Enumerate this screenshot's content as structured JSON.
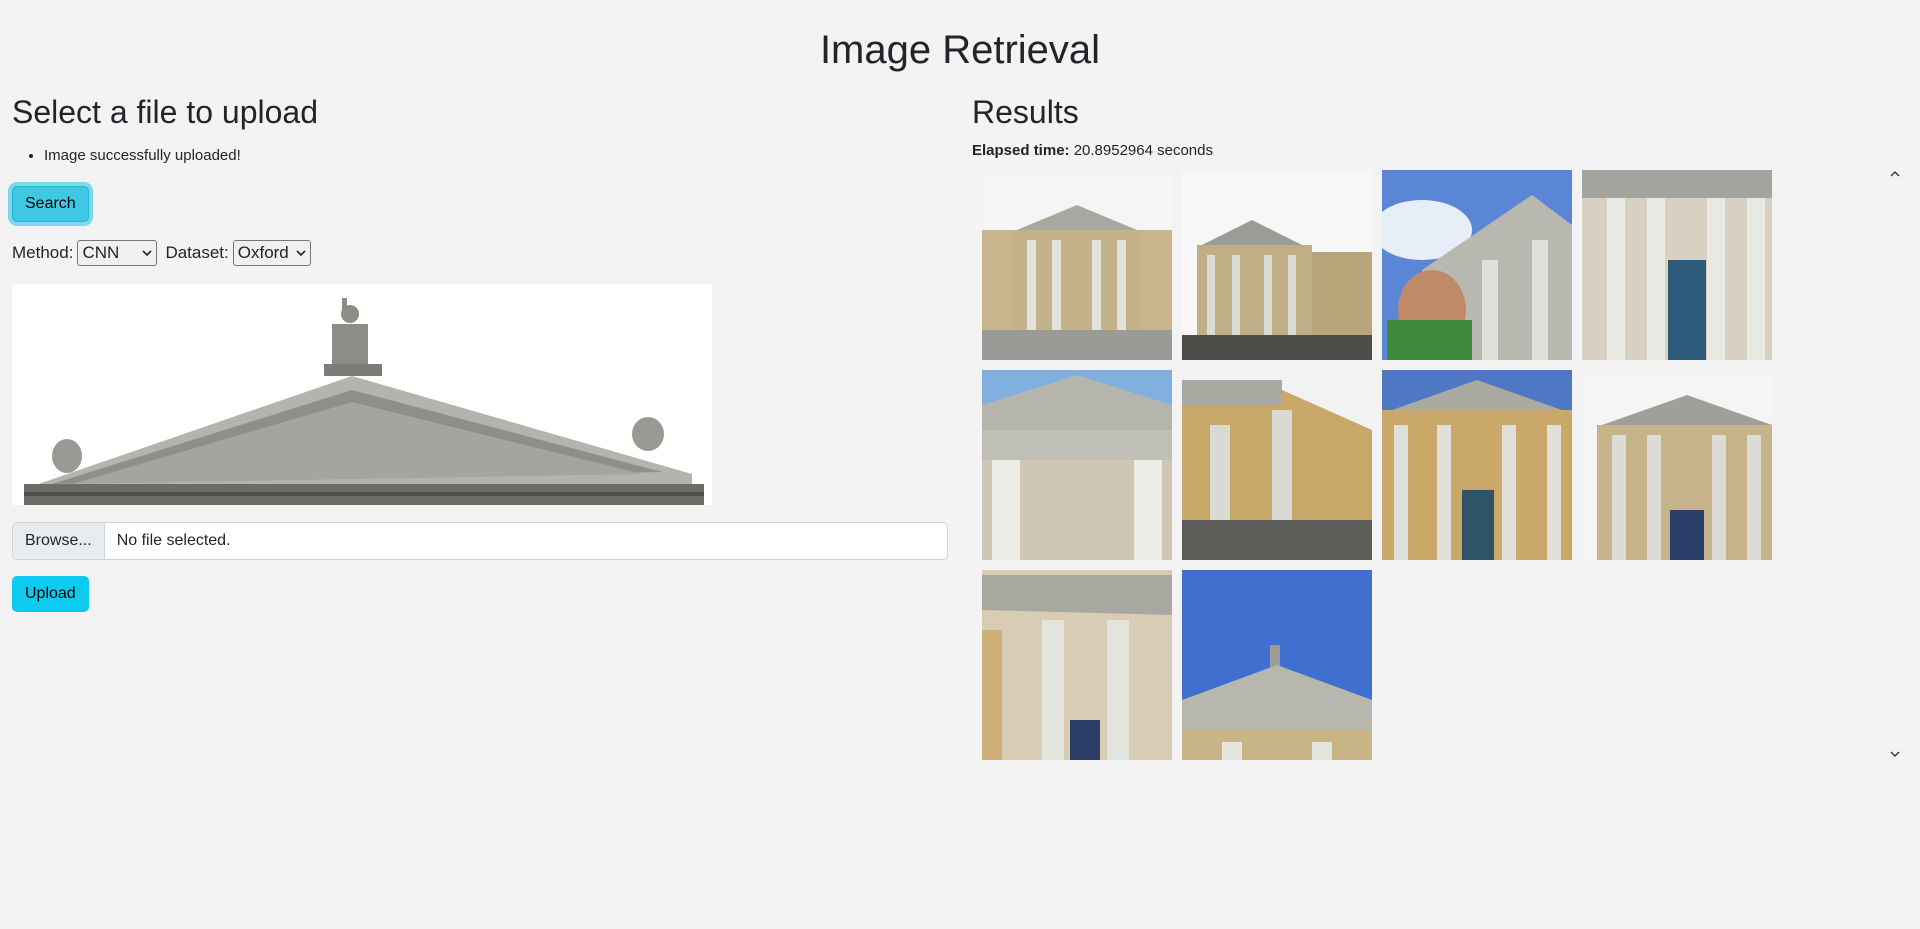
{
  "page": {
    "title": "Image Retrieval"
  },
  "upload": {
    "heading": "Select a file to upload",
    "messages": [
      "Image successfully uploaded!"
    ],
    "search_button": "Search",
    "method_label": "Method:",
    "method_value": "CNN",
    "dataset_label": "Dataset:",
    "dataset_value": "Oxford",
    "browse_button": "Browse...",
    "file_status": "No file selected.",
    "upload_button": "Upload"
  },
  "results": {
    "heading": "Results",
    "elapsed_label": "Elapsed time:",
    "elapsed_value": "20.8952964 seconds",
    "count": 10
  },
  "colors": {
    "background": "#f3f3f3",
    "accent": "#0dcaf0",
    "sky": "#5b86d6",
    "stone": "#9a9a92",
    "facade": "#c9a86a"
  }
}
